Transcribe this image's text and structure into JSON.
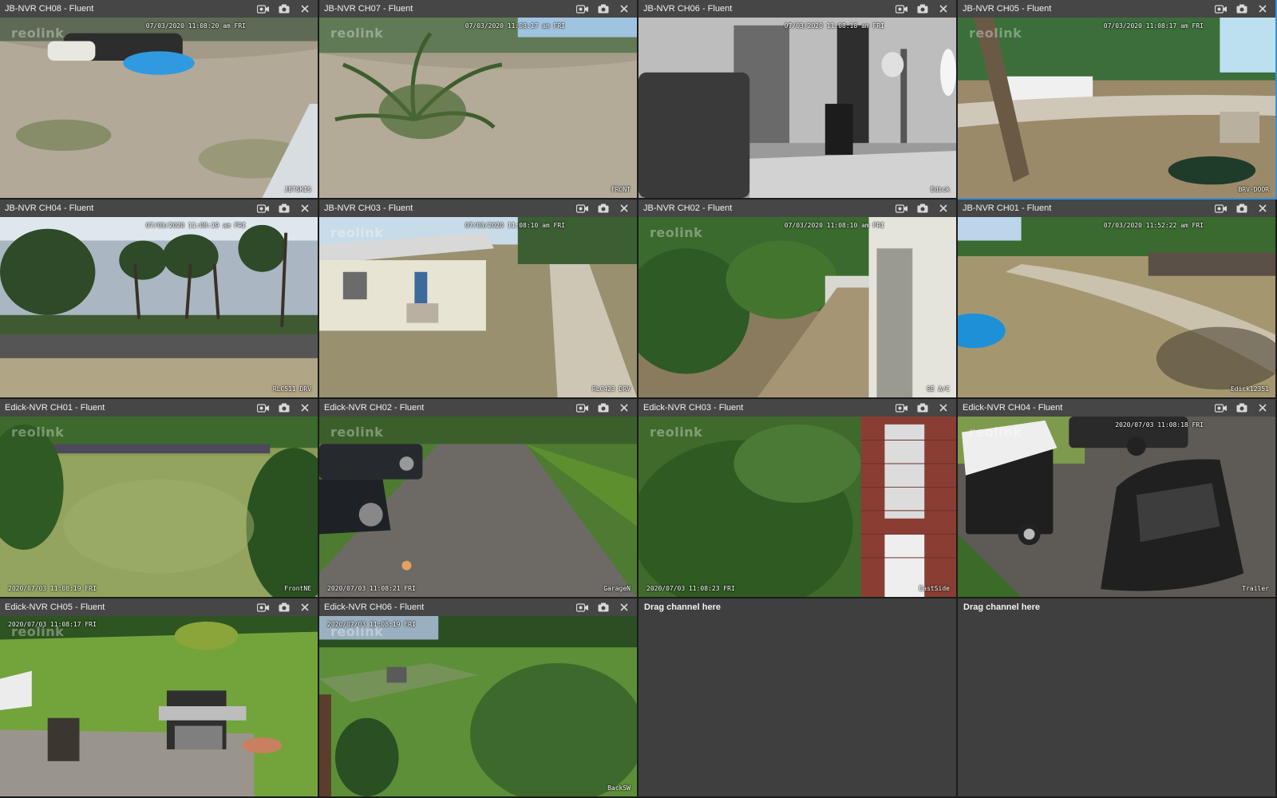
{
  "tiles": [
    {
      "title": "JB-NVR CH08 - Fluent",
      "timestamp": "07/03/2020 11:08:20 am FRI",
      "ts_pos": "tr",
      "name": "JETSKIS",
      "watermark": "reolink",
      "scene": "yard-boats"
    },
    {
      "title": "JB-NVR CH07 - Fluent",
      "timestamp": "07/03/2020 11:08:17 am FRI",
      "ts_pos": "tr",
      "name": "FRONT",
      "watermark": "reolink",
      "scene": "yard-palm"
    },
    {
      "title": "JB-NVR CH06 - Fluent",
      "timestamp": "07/03/2020 11:08:18 am FRI",
      "ts_pos": "tr",
      "name": "Edick",
      "watermark": "",
      "scene": "indoor-gray"
    },
    {
      "title": "JB-NVR CH05 - Fluent",
      "timestamp": "07/03/2020 11:08:17 am FRI",
      "ts_pos": "tr",
      "name": "BRV-DOOR",
      "watermark": "reolink",
      "scene": "yard-tree"
    },
    {
      "title": "JB-NVR CH04 - Fluent",
      "timestamp": "07/03/2020 11:08:19 am FRI",
      "ts_pos": "tr",
      "name": "RLC511 DRV",
      "watermark": "",
      "scene": "lake"
    },
    {
      "title": "JB-NVR CH03 - Fluent",
      "timestamp": "07/03/2020 11:08:10 am FRI",
      "ts_pos": "tr",
      "name": "RLC423 DRV",
      "watermark": "reolink",
      "scene": "house"
    },
    {
      "title": "JB-NVR CH02 - Fluent",
      "timestamp": "07/03/2020 11:08:10 am FRI",
      "ts_pos": "tr",
      "name": "SE A/C",
      "watermark": "reolink",
      "scene": "side-ac"
    },
    {
      "title": "JB-NVR CH01 - Fluent",
      "timestamp": "07/03/2020 11:52:22 am FRI",
      "ts_pos": "tr",
      "name": "Edick12351",
      "watermark": "",
      "scene": "driveway-sand"
    },
    {
      "title": "Edick-NVR CH01 - Fluent",
      "timestamp": "2020/07/03 11:08:19 FRI",
      "ts_pos": "bl",
      "name": "FrontNE",
      "watermark": "reolink",
      "scene": "lawn"
    },
    {
      "title": "Edick-NVR CH02 - Fluent",
      "timestamp": "2020/07/03 11:08:21 FRI",
      "ts_pos": "bl",
      "name": "GarageN",
      "watermark": "reolink",
      "scene": "driveway-asphalt"
    },
    {
      "title": "Edick-NVR CH03 - Fluent",
      "timestamp": "2020/07/03 11:08:23 FRI",
      "ts_pos": "bl",
      "name": "EastSide",
      "watermark": "reolink",
      "scene": "brick-side"
    },
    {
      "title": "Edick-NVR CH04 - Fluent",
      "timestamp": "2020/07/03 11:08:18 FRI",
      "ts_pos": "tr",
      "name": "Trailer",
      "watermark": "reolink",
      "scene": "trailer"
    },
    {
      "title": "Edick-NVR CH05 - Fluent",
      "timestamp": "2020/07/03 11:08:17 FRI",
      "ts_pos": "tl",
      "name": "",
      "watermark": "reolink",
      "scene": "patio-grill"
    },
    {
      "title": "Edick-NVR CH06 - Fluent",
      "timestamp": "2020/07/03 11:08:19 FRI",
      "ts_pos": "tl",
      "name": "BackSW",
      "watermark": "reolink",
      "scene": "garden"
    },
    {
      "empty": true,
      "label": "Drag channel here"
    },
    {
      "empty": true,
      "label": "Drag channel here"
    }
  ],
  "active_tile": 3,
  "icons": {
    "record": "video-camera-icon",
    "snapshot": "camera-icon",
    "close": "close-icon"
  },
  "colors": {
    "titlebar": "#464646",
    "empty": "#3f3f3f",
    "active_border": "#3b8fd8"
  }
}
